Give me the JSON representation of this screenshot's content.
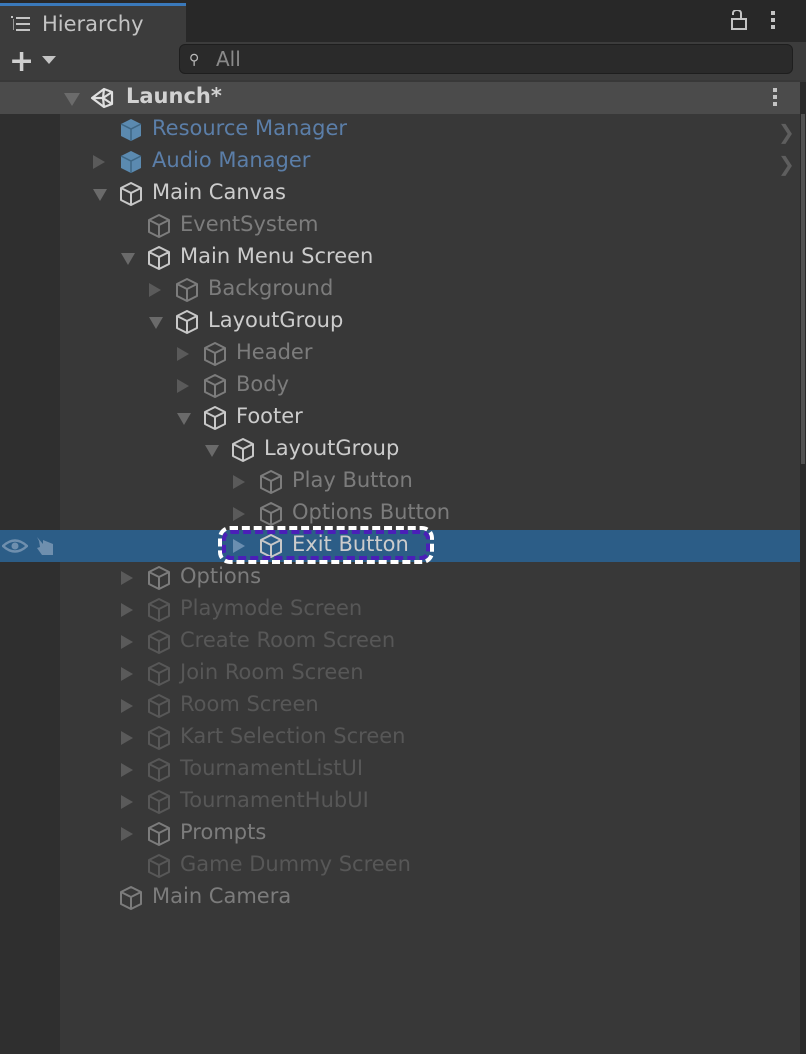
{
  "panel": {
    "title": "Hierarchy",
    "tab_icon": "hierarchy-list-icon",
    "lock_icon": "unlocked-lock-icon",
    "menu_icon": "kebab-menu-icon"
  },
  "toolbar": {
    "add_icon": "plus-icon",
    "search_placeholder": "All",
    "search_value": ""
  },
  "scene": {
    "name": "Launch*",
    "icon": "unity-logo-icon"
  },
  "colors": {
    "selection": "#2c5d87",
    "prefab": "#5b7ea8",
    "focus_outline": "#4a1fb8",
    "background": "#383838"
  },
  "items": [
    {
      "name": "Resource Manager",
      "depth": 1,
      "arrow": "none",
      "style": "prefab",
      "has_chevron": true
    },
    {
      "name": "Audio Manager",
      "depth": 1,
      "arrow": "collapsed",
      "style": "prefab",
      "has_chevron": true
    },
    {
      "name": "Main Canvas",
      "depth": 1,
      "arrow": "expanded",
      "style": "bright"
    },
    {
      "name": "EventSystem",
      "depth": 2,
      "arrow": "none",
      "style": "normal"
    },
    {
      "name": "Main Menu Screen",
      "depth": 2,
      "arrow": "expanded",
      "style": "bright"
    },
    {
      "name": "Background",
      "depth": 3,
      "arrow": "collapsed",
      "style": "normal"
    },
    {
      "name": "LayoutGroup",
      "depth": 3,
      "arrow": "expanded",
      "style": "bright"
    },
    {
      "name": "Header",
      "depth": 4,
      "arrow": "collapsed",
      "style": "normal"
    },
    {
      "name": "Body",
      "depth": 4,
      "arrow": "collapsed",
      "style": "normal"
    },
    {
      "name": "Footer",
      "depth": 4,
      "arrow": "expanded",
      "style": "bright"
    },
    {
      "name": "LayoutGroup",
      "depth": 5,
      "arrow": "expanded",
      "style": "bright"
    },
    {
      "name": "Play Button",
      "depth": 6,
      "arrow": "collapsed",
      "style": "normal"
    },
    {
      "name": "Options Button",
      "depth": 6,
      "arrow": "collapsed",
      "style": "normal"
    },
    {
      "name": "Exit Button",
      "depth": 6,
      "arrow": "collapsed",
      "style": "bright",
      "selected": true
    },
    {
      "name": "Options",
      "depth": 2,
      "arrow": "collapsed",
      "style": "normal"
    },
    {
      "name": "Playmode Screen",
      "depth": 2,
      "arrow": "collapsed",
      "style": "dim"
    },
    {
      "name": "Create Room Screen",
      "depth": 2,
      "arrow": "collapsed",
      "style": "dim"
    },
    {
      "name": "Join Room Screen",
      "depth": 2,
      "arrow": "collapsed",
      "style": "dim"
    },
    {
      "name": "Room Screen",
      "depth": 2,
      "arrow": "collapsed",
      "style": "dim"
    },
    {
      "name": "Kart Selection Screen",
      "depth": 2,
      "arrow": "collapsed",
      "style": "dim"
    },
    {
      "name": "TournamentListUI",
      "depth": 2,
      "arrow": "collapsed",
      "style": "dim"
    },
    {
      "name": "TournamentHubUI",
      "depth": 2,
      "arrow": "collapsed",
      "style": "dim"
    },
    {
      "name": "Prompts",
      "depth": 2,
      "arrow": "collapsed",
      "style": "normal"
    },
    {
      "name": "Game Dummy Screen",
      "depth": 2,
      "arrow": "none",
      "style": "dim"
    },
    {
      "name": "Main Camera",
      "depth": 1,
      "arrow": "none",
      "style": "normal"
    }
  ],
  "selected_row_icons": [
    "visibility-eye-icon",
    "pickable-hand-icon"
  ]
}
